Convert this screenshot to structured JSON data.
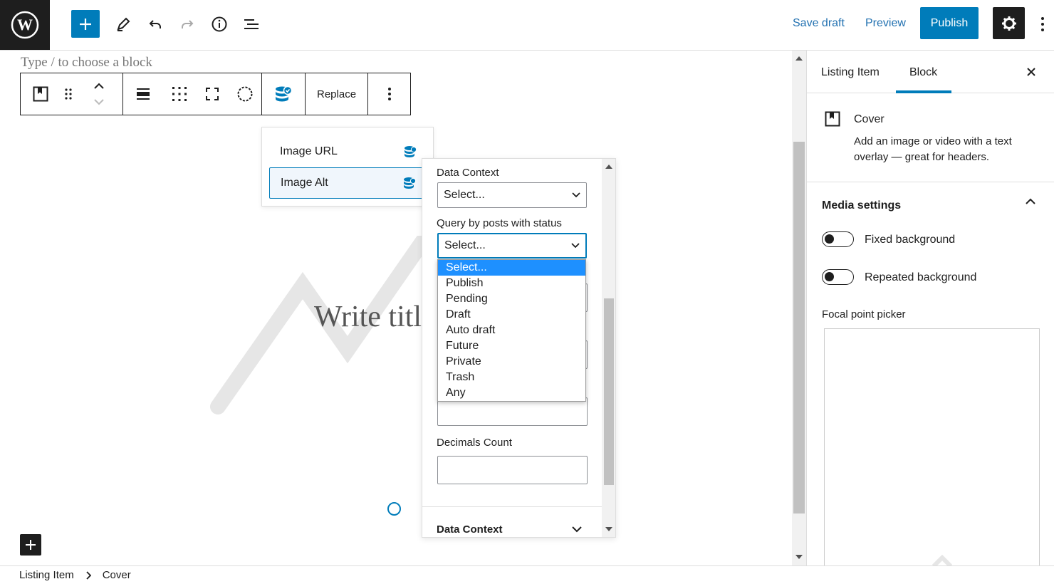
{
  "topbar": {
    "save_draft": "Save draft",
    "preview": "Preview",
    "publish": "Publish"
  },
  "editor": {
    "type_hint": "Type / to choose a block",
    "replace": "Replace",
    "write_title": "Write title…"
  },
  "binding_popover": {
    "items": [
      {
        "label": "Image URL",
        "active": false
      },
      {
        "label": "Image Alt",
        "active": true
      }
    ]
  },
  "data_context_panel": {
    "data_context_label": "Data Context",
    "data_context_value": "Select...",
    "status_label": "Query by posts with status",
    "status_value": "Select...",
    "decimals_label": "Decimals Count",
    "footer_title": "Data Context",
    "status_options": [
      "Select...",
      "Publish",
      "Pending",
      "Draft",
      "Auto draft",
      "Future",
      "Private",
      "Trash",
      "Any"
    ],
    "status_selected": "Select..."
  },
  "sidebar": {
    "tabs": [
      "Listing Item",
      "Block"
    ],
    "active_tab": "Block",
    "block_name": "Cover",
    "block_description": "Add an image or video with a text overlay — great for headers.",
    "media_settings_title": "Media settings",
    "fixed_background": "Fixed background",
    "repeated_background": "Repeated background",
    "focal_point_label": "Focal point picker"
  },
  "breadcrumb": {
    "items": [
      "Listing Item",
      "Cover"
    ]
  },
  "colors": {
    "accent": "#007cba",
    "dark": "#1e1e1e",
    "link": "#2271b1",
    "dropdown_highlight": "#1e90ff"
  }
}
